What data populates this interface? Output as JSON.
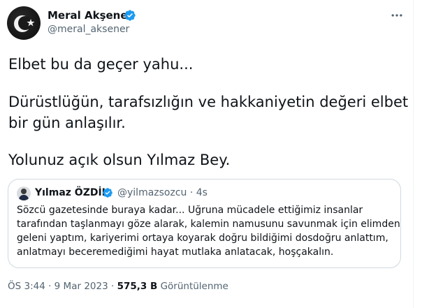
{
  "author": {
    "name": "Meral Akşener",
    "handle": "@meral_aksener"
  },
  "tweet": {
    "lines": [
      "Elbet bu da geçer yahu...",
      "Dürüstlüğün, tarafsızlığın ve hakkaniyetin değeri elbet",
      "bir gün anlaşılır.",
      "Yolunuz açık olsun Yılmaz Bey."
    ]
  },
  "quoted": {
    "name": "Yılmaz ÖZDİL",
    "handle_time": "@yilmazsozcu · 4s",
    "lines": [
      "Sözcü gazetesinde buraya kadar... Uğruna mücadele ettiğimiz insanlar",
      "tarafından taşlanmayı göze alarak, kalemin namusunu savunmak için elimden",
      "geleni yaptım, kariyerimi ortaya koyarak doğru bildiğimi dosdoğru anlattım,",
      "anlatmayı beceremediğimi hayat mutlaka anlatacak, hoşçakalın."
    ]
  },
  "meta": {
    "timestamp": "ÖS 3:44 · 9 Mar 2023",
    "separator": " · ",
    "views_count": "575,3 B",
    "views_label": "Görüntülenme"
  },
  "icons": {
    "verified": "verified-badge-icon",
    "more": "more-options-icon",
    "avatar_emblem": "crescent-star-emblem"
  },
  "colors": {
    "verified_blue": "#1d9bf0",
    "secondary_text": "#536471",
    "primary_text": "#0f1419",
    "border": "#cfd9de"
  }
}
